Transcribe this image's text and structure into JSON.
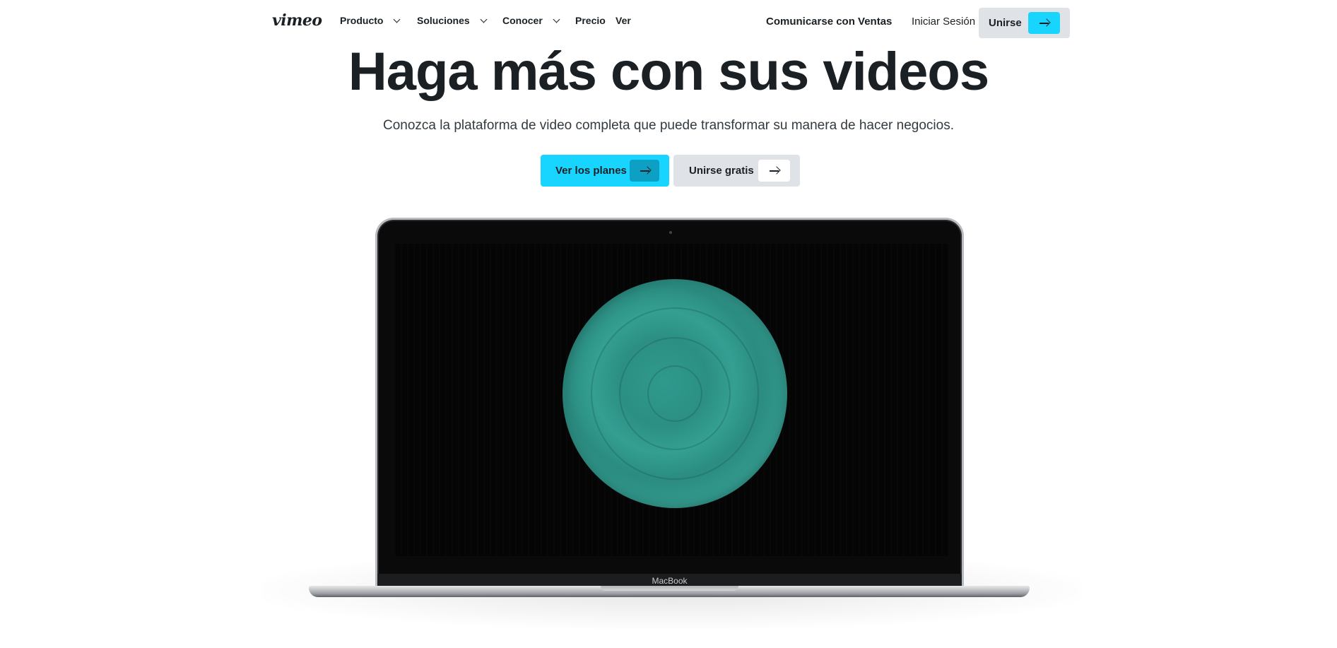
{
  "brand": {
    "logo": "vimeo"
  },
  "nav": {
    "items": [
      {
        "label": "Producto",
        "has_dropdown": true
      },
      {
        "label": "Soluciones",
        "has_dropdown": true
      },
      {
        "label": "Conocer",
        "has_dropdown": true
      },
      {
        "label": "Precio",
        "has_dropdown": false
      },
      {
        "label": "Ver",
        "has_dropdown": false
      }
    ],
    "contact_sales": "Comunicarse con Ventas",
    "login": "Iniciar Sesión",
    "join": "Unirse"
  },
  "hero": {
    "title": "Haga más con sus videos",
    "subtitle": "Conozca la plataforma de video completa que puede transformar su manera de hacer negocios.",
    "primary_cta": "Ver los planes",
    "secondary_cta": "Unirse gratis"
  },
  "laptop": {
    "brand_label": "MacBook"
  },
  "colors": {
    "accent": "#17d5ff",
    "secondary_bg": "#dfe3e8",
    "text": "#1a2024",
    "video_circle": "#2f9a8d"
  },
  "icons": {
    "arrow": "arrow-right-icon",
    "dropdown": "chevron-down-icon"
  }
}
